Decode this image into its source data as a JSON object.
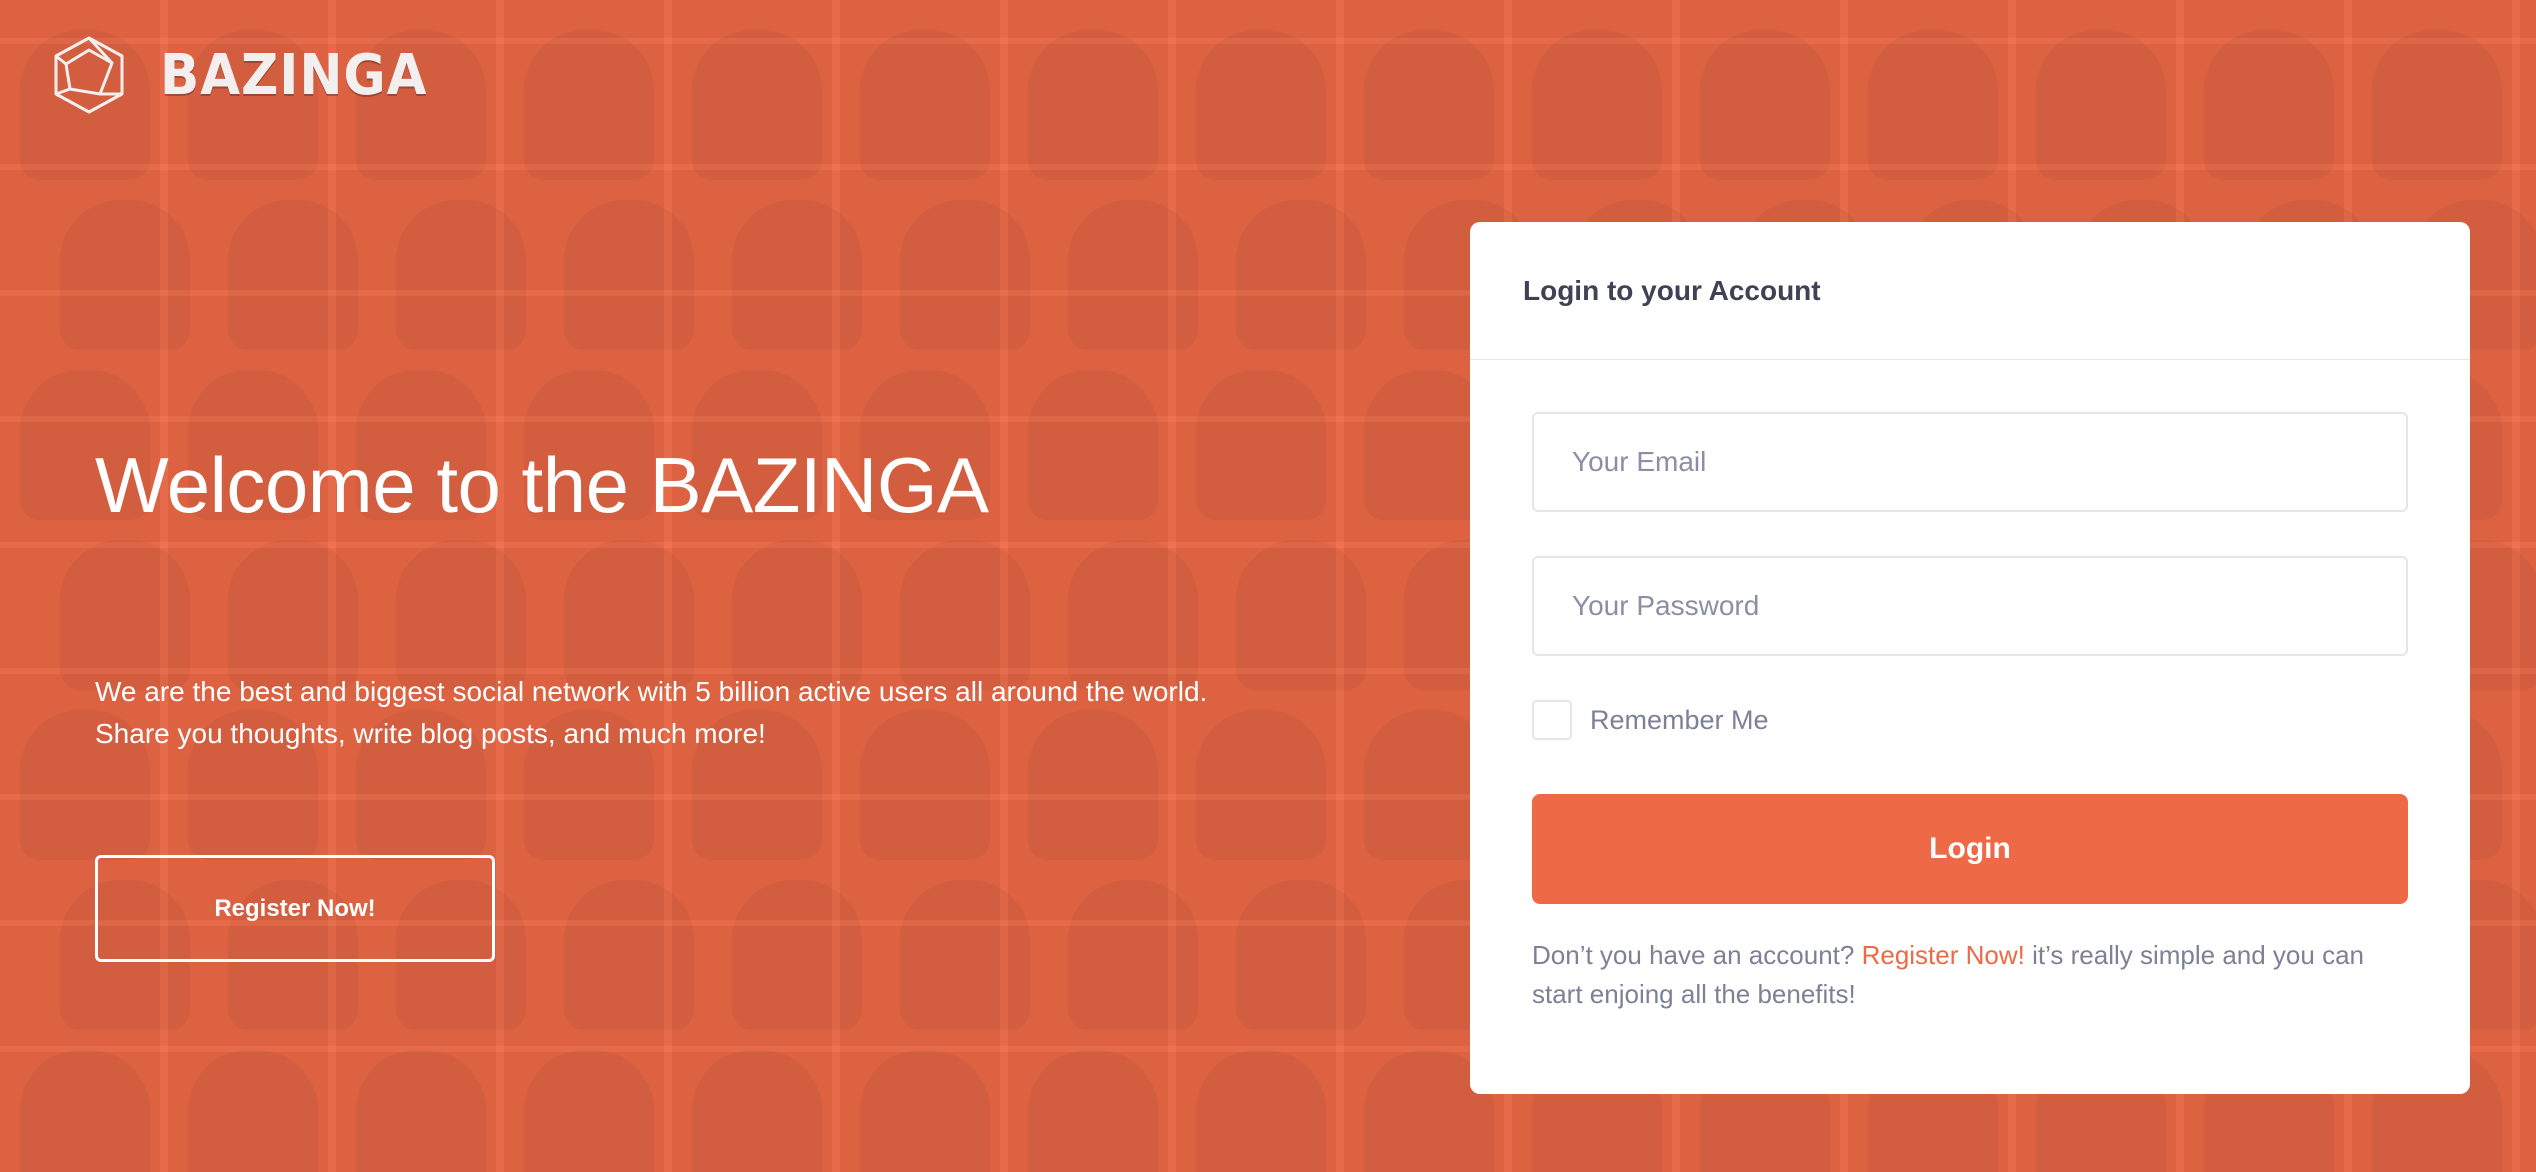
{
  "brand": {
    "name": "BAZINGA"
  },
  "hero": {
    "title": "Welcome to the BAZINGA",
    "line1": "We are the best and biggest social network with 5 billion active users all around the world.",
    "line2": "Share you thoughts, write blog posts, and much more!",
    "register_label": "Register Now!"
  },
  "login": {
    "title": "Login to your Account",
    "email_placeholder": "Your Email",
    "password_placeholder": "Your Password",
    "remember_label": "Remember Me",
    "button_label": "Login",
    "signup_prefix": "Don’t you have an account?",
    "signup_link": "Register Now!",
    "signup_suffix": "it’s really simple and you can start enjoing all the benefits!"
  },
  "colors": {
    "accent": "#ee6a47",
    "card": "#ffffff",
    "title_text": "#3f4254",
    "muted_text": "#7d8196"
  },
  "icons": {
    "logo": "bazinga-logo-icon"
  }
}
